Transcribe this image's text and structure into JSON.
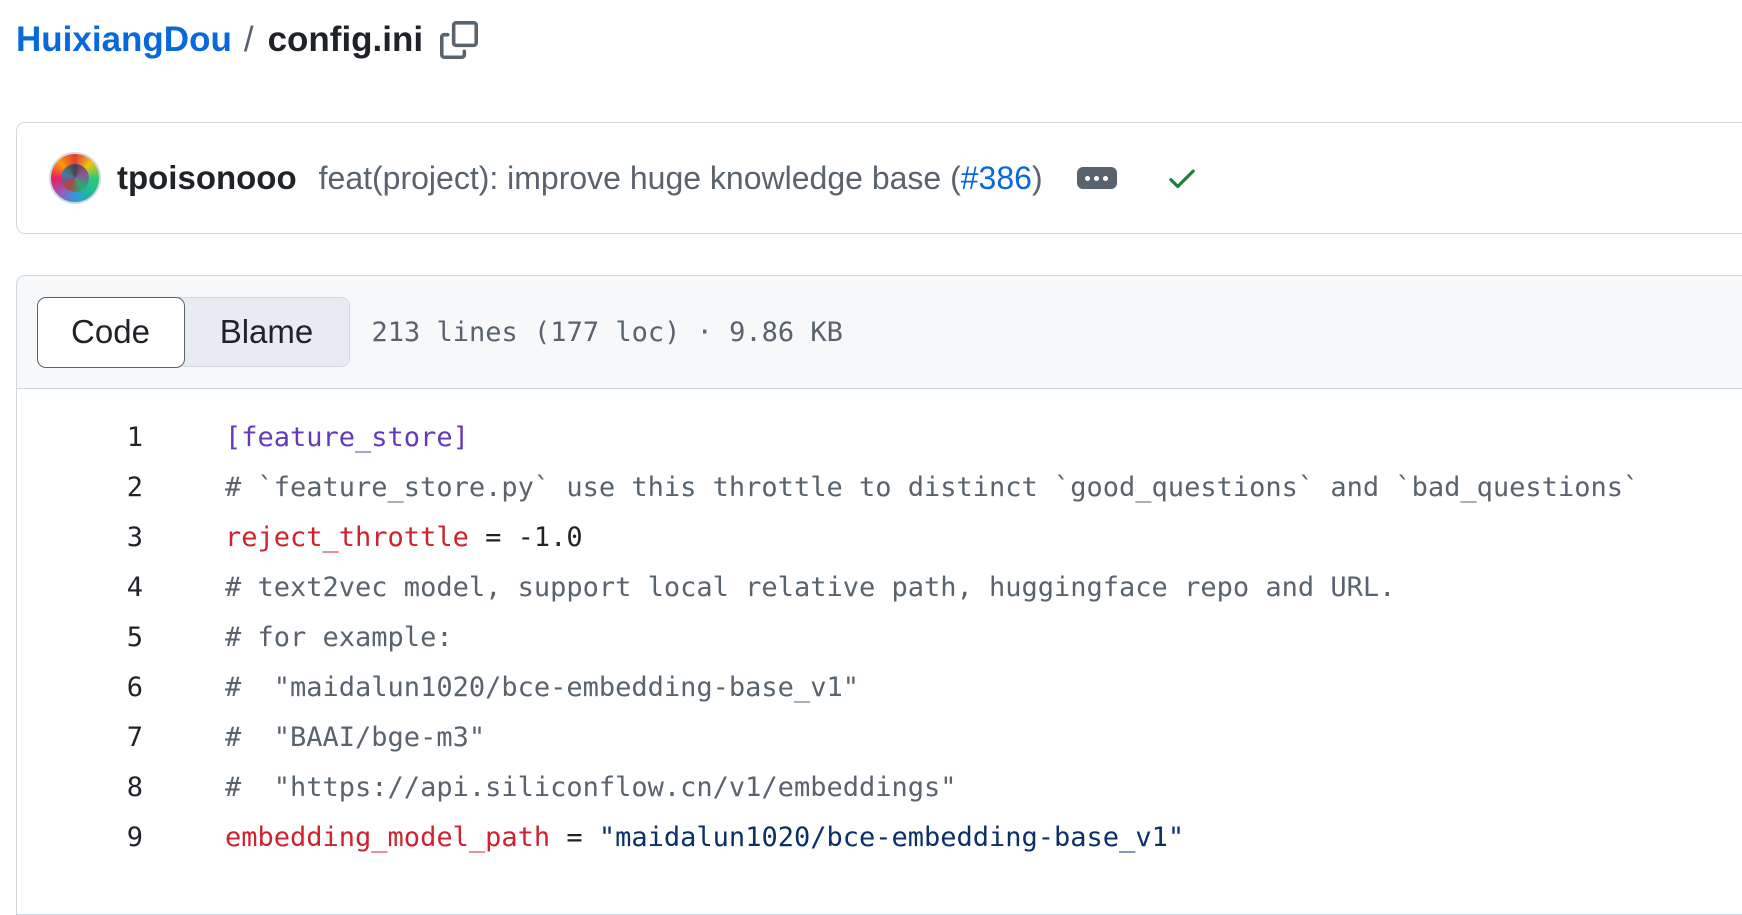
{
  "breadcrumb": {
    "repo": "HuixiangDou",
    "separator": "/",
    "file": "config.ini"
  },
  "commit": {
    "author": "tpoisonooo",
    "message_prefix": "feat(project): improve huge knowledge base (",
    "pr": "#386",
    "message_suffix": ")",
    "status": "success"
  },
  "file": {
    "tabs": [
      "Code",
      "Blame"
    ],
    "active_tab": "Code",
    "meta": "213 lines (177 loc) · 9.86 KB"
  },
  "code": {
    "lines": [
      {
        "n": "1",
        "parts": [
          {
            "t": "[feature_store]",
            "c": "section"
          }
        ]
      },
      {
        "n": "2",
        "parts": [
          {
            "t": "# `feature_store.py` use this throttle to distinct `good_questions` and `bad_questions`",
            "c": "comment"
          }
        ]
      },
      {
        "n": "3",
        "parts": [
          {
            "t": "reject_throttle",
            "c": "key"
          },
          {
            "t": " = ",
            "c": "plain"
          },
          {
            "t": "-1.0",
            "c": "num"
          }
        ]
      },
      {
        "n": "4",
        "parts": [
          {
            "t": "# text2vec model, support local relative path, huggingface repo and URL.",
            "c": "comment"
          }
        ]
      },
      {
        "n": "5",
        "parts": [
          {
            "t": "# for example:",
            "c": "comment"
          }
        ]
      },
      {
        "n": "6",
        "parts": [
          {
            "t": "#  \"maidalun1020/bce-embedding-base_v1\"",
            "c": "comment"
          }
        ]
      },
      {
        "n": "7",
        "parts": [
          {
            "t": "#  \"BAAI/bge-m3\"",
            "c": "comment"
          }
        ]
      },
      {
        "n": "8",
        "parts": [
          {
            "t": "#  \"https://api.siliconflow.cn/v1/embeddings\"",
            "c": "comment"
          }
        ]
      },
      {
        "n": "9",
        "parts": [
          {
            "t": "embedding_model_path",
            "c": "key"
          },
          {
            "t": " = ",
            "c": "plain"
          },
          {
            "t": "\"maidalun1020/bce-embedding-base_v1\"",
            "c": "str"
          }
        ]
      }
    ]
  }
}
